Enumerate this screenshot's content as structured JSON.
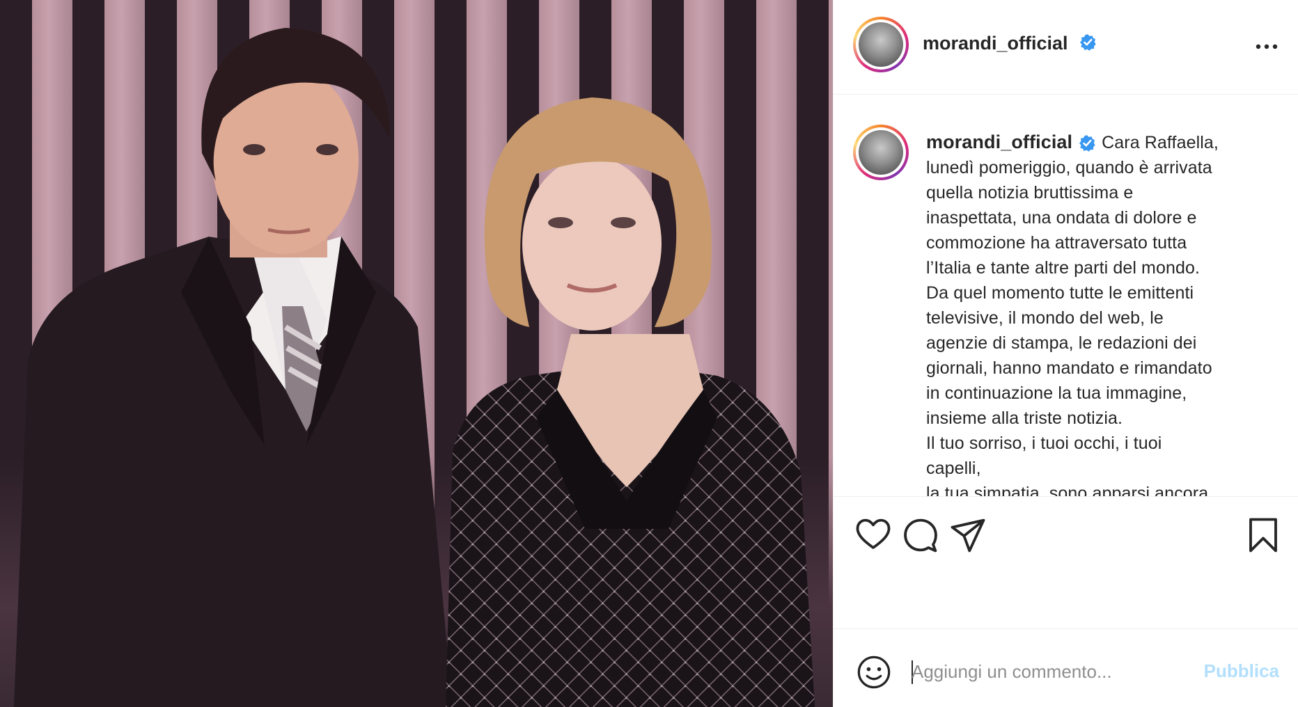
{
  "post": {
    "image_alt": "photo",
    "username": "morandi_official",
    "more_icon": "more-horizontal-icon",
    "verified_color": "#3897f0"
  },
  "caption": {
    "username": "morandi_official",
    "lines": [
      "Cara Raffaella,",
      "lunedì pomeriggio, quando è arrivata",
      "quella notizia bruttissima e",
      "inaspettata, una ondata di dolore e",
      "commozione ha attraversato tutta",
      "l’Italia e tante altre parti del mondo.",
      "Da quel momento tutte le emittenti",
      "televisive, il mondo del web, le",
      "agenzie di stampa, le redazioni dei",
      "giornali, hanno mandato e rimandato",
      "in continuazione la tua immagine,",
      "insieme alla triste notizia.",
      "Il tuo sorriso, i tuoi occhi, i tuoi",
      "capelli,",
      "la tua simpatia, sono apparsi ancora"
    ]
  },
  "actions": {
    "like_icon": "heart-icon",
    "comment_icon": "comment-icon",
    "share_icon": "paper-plane-icon",
    "save_icon": "bookmark-icon"
  },
  "comment_bar": {
    "emoji_icon": "smiley-icon",
    "placeholder": "Aggiungi un commento...",
    "publish_label": "Pubblica",
    "publish_color": "#b2dffc"
  }
}
